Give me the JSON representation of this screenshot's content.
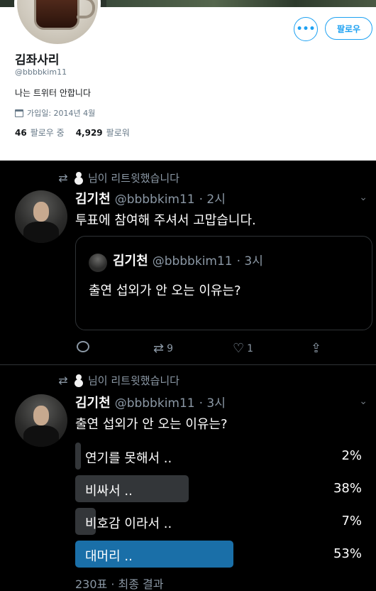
{
  "profile": {
    "follow_button": "팔로우",
    "more_button": "•••",
    "name": "김좌사리",
    "handle": "@bbbbkim11",
    "bio": "나는 트위터 안합니다",
    "joined": "가입일: 2014년 4월",
    "following_count": "46",
    "following_label": "팔로우 중",
    "followers_count": "4,929",
    "followers_label": "팔로워"
  },
  "tweet1": {
    "retweeted_by": "님이 리트윗했습니다",
    "name": "김기천",
    "handle": "@bbbbkim11",
    "time": "· 2시",
    "text": "투표에 참여해 주셔서 고맙습니다.",
    "quote": {
      "name": "김기천",
      "handle": "@bbbbkim11",
      "time": "· 3시",
      "text": "출연 섭외가 안 오는 이유는?"
    },
    "retweets": "9",
    "likes": "1"
  },
  "tweet2": {
    "retweeted_by": "님이 리트윗했습니다",
    "name": "김기천",
    "handle": "@bbbbkim11",
    "time": "· 3시",
    "text": "출연 섭외가 안 오는 이유는?",
    "poll": [
      {
        "label": "연기를 못해서 ..",
        "percent_text": "2%",
        "percent": 2,
        "winner": false
      },
      {
        "label": "비싸서 ..",
        "percent_text": "38%",
        "percent": 38,
        "winner": false
      },
      {
        "label": "비호감 이라서 ..",
        "percent_text": "7%",
        "percent": 7,
        "winner": false
      },
      {
        "label": "대머리 ..",
        "percent_text": "53%",
        "percent": 53,
        "winner": true
      }
    ],
    "poll_footer": "230표 · 최종 결과"
  },
  "icons": {
    "retweet": "retweet-icon",
    "reply": "reply-icon",
    "like": "heart-icon",
    "share": "share-icon",
    "calendar": "calendar-icon",
    "chevron": "chevron-down-icon"
  },
  "colors": {
    "accent": "#1da1f2",
    "dark_bg": "#000000",
    "poll_bar": "#333639",
    "poll_winner": "#1a6fa8"
  }
}
